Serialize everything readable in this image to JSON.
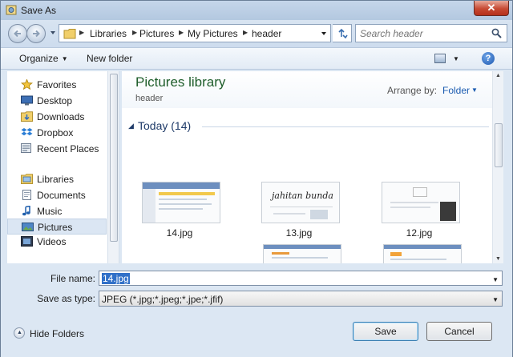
{
  "window": {
    "title": "Save As",
    "close_label": "✕"
  },
  "address": {
    "breadcrumb": [
      "Libraries",
      "Pictures",
      "My Pictures",
      "header"
    ],
    "search_placeholder": "Search header"
  },
  "toolbar": {
    "organize": "Organize",
    "new_folder": "New folder",
    "help": "?"
  },
  "nav": {
    "favorites_header": "Favorites",
    "favorites": [
      "Desktop",
      "Downloads",
      "Dropbox",
      "Recent Places"
    ],
    "libraries_header": "Libraries",
    "libraries": [
      "Documents",
      "Music",
      "Pictures",
      "Videos"
    ],
    "selected": "Pictures"
  },
  "content": {
    "library_title": "Pictures library",
    "library_subtitle": "header",
    "arrange_label": "Arrange by:",
    "arrange_value": "Folder",
    "group_label": "Today (14)",
    "files": [
      "14.jpg",
      "13.jpg",
      "12.jpg"
    ]
  },
  "form": {
    "filename_label": "File name:",
    "filename_value": "14.jpg",
    "filetype_label": "Save as type:",
    "filetype_value": "JPEG (*.jpg;*.jpeg;*.jpe;*.jfif)",
    "hide_folders": "Hide Folders",
    "save": "Save",
    "cancel": "Cancel"
  },
  "thumb_text": {
    "t13": "jahitan bunda"
  },
  "colors": {
    "library_title": "#1e5d2a",
    "link_blue": "#1a5bb0",
    "selection": "#3070c8"
  }
}
